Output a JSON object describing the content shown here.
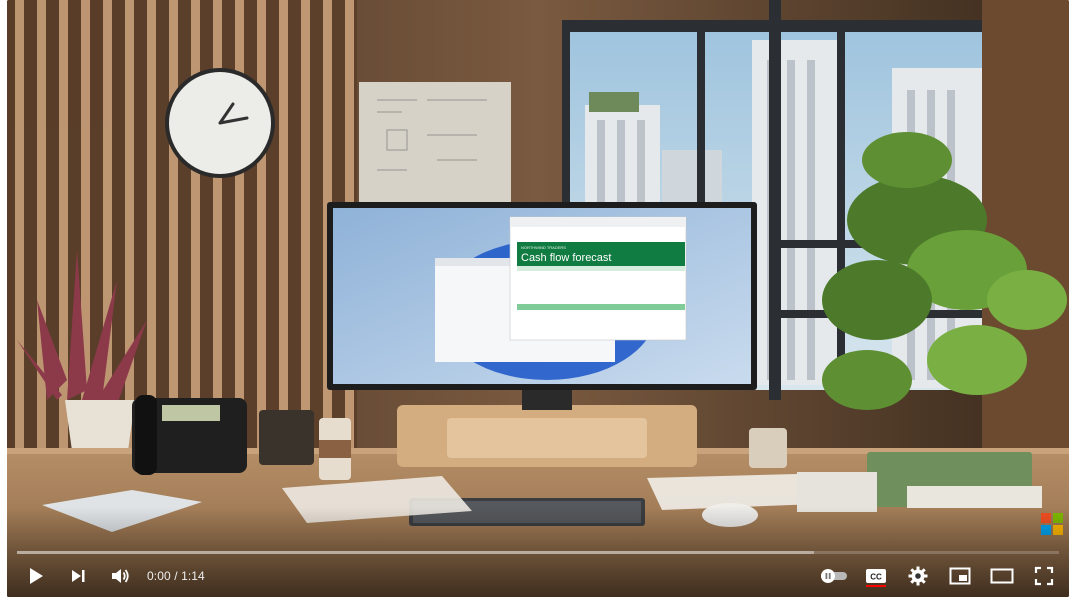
{
  "video": {
    "embedded_title": "NORTHWIND TRADERS",
    "embedded_heading": "Cash flow forecast",
    "scene_icon": "office-desk-ultrawide-monitor-scene",
    "watermark_icon": "microsoft-logo",
    "watermark_colors": [
      "#f25022",
      "#7fba00",
      "#00a4ef",
      "#ffb900"
    ]
  },
  "player": {
    "progress": {
      "played_fraction": 0.0,
      "loaded_fraction": 0.765,
      "played_color": "#ff0000"
    },
    "controls": {
      "play_icon": "play-icon",
      "next_icon": "next-icon",
      "volume_icon": "volume-icon",
      "time_current": "0:00",
      "time_separator": " / ",
      "time_duration": "1:14",
      "autoplay_icon": "autoplay-toggle-icon",
      "captions_icon": "captions-icon",
      "captions_on_color": "#ff0000",
      "settings_icon": "gear-icon",
      "miniplayer_icon": "miniplayer-icon",
      "theater_icon": "theater-mode-icon",
      "fullscreen_icon": "fullscreen-icon"
    }
  }
}
